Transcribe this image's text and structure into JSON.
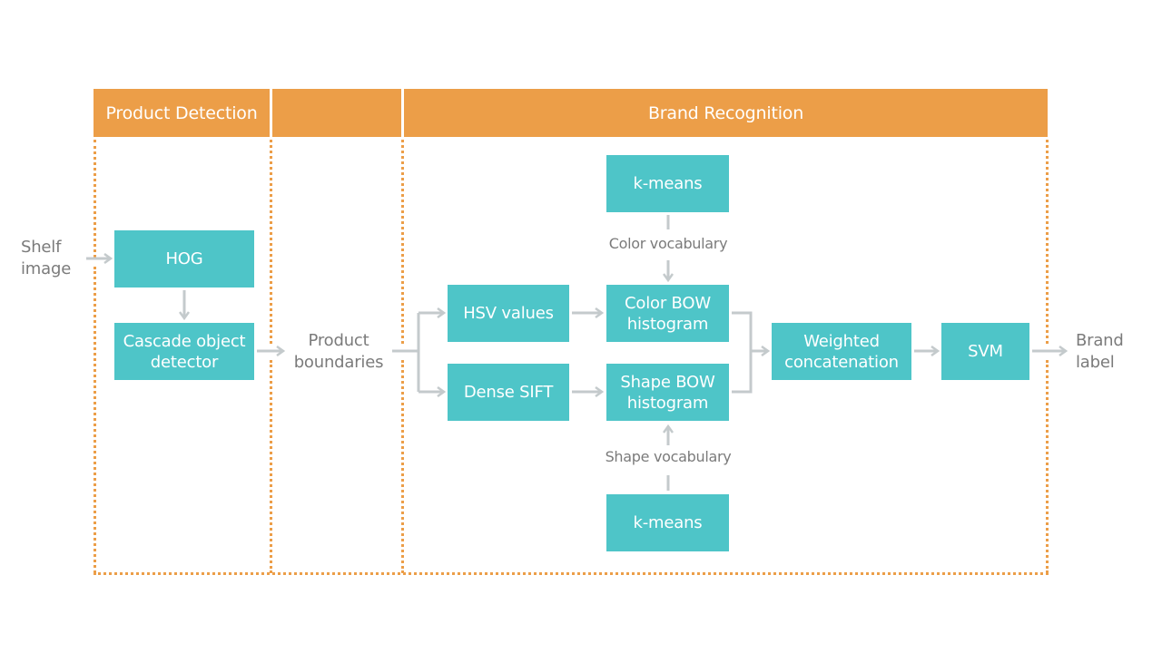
{
  "colors": {
    "header": "#ec9e48",
    "box": "#4ec5c8",
    "connector": "#c4cacc",
    "label": "#7b7b7b"
  },
  "headers": {
    "product_detection": "Product Detection",
    "middle": "",
    "brand_recognition": "Brand Recognition"
  },
  "inputs": {
    "shelf_image": [
      "Shelf",
      "image"
    ]
  },
  "outputs": {
    "brand_label": [
      "Brand",
      "label"
    ]
  },
  "intermediate": {
    "product_boundaries": [
      "Product",
      "boundaries"
    ]
  },
  "boxes": {
    "hog": [
      "HOG"
    ],
    "cascade": [
      "Cascade object",
      "detector"
    ],
    "hsv": [
      "HSV values"
    ],
    "dense_sift": [
      "Dense SIFT"
    ],
    "color_bow": [
      "Color BOW",
      "histogram"
    ],
    "shape_bow": [
      "Shape BOW",
      "histogram"
    ],
    "kmeans_top": [
      "k-means"
    ],
    "kmeans_bottom": [
      "k-means"
    ],
    "weighted": [
      "Weighted",
      "concatenation"
    ],
    "svm": [
      "SVM"
    ]
  },
  "edge_labels": {
    "color_vocab": "Color vocabulary",
    "shape_vocab": "Shape vocabulary"
  }
}
